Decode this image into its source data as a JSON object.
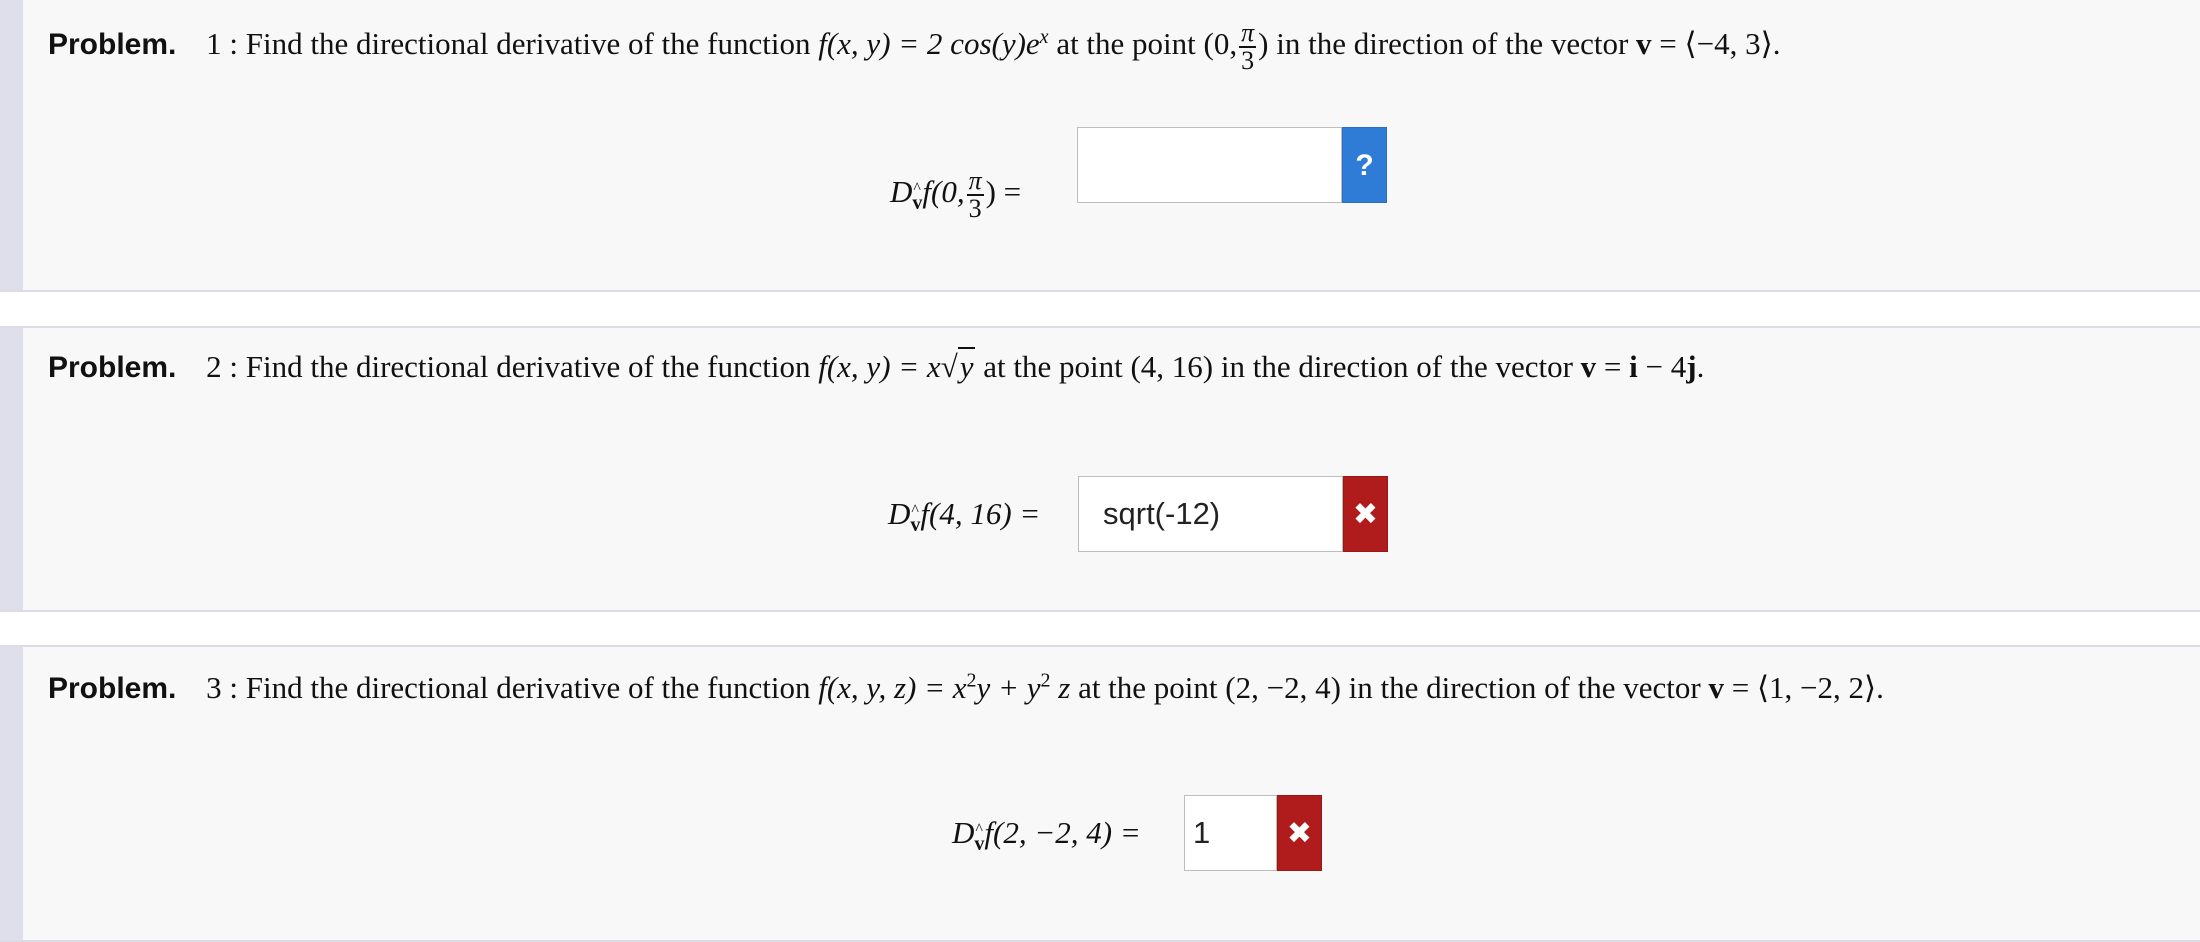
{
  "problems": [
    {
      "label": "Problem.",
      "number": "1 :",
      "text_intro": "Find the directional derivative of the function",
      "function_lhs": "f(x, y) = 2 cos(y)e",
      "function_sup": "x",
      "text_point": "at the point (0,",
      "point_frac_num": "π",
      "point_frac_den": "3",
      "text_point_end": ")",
      "text_direction": "in the direction of the vector",
      "vector_name": "v",
      "vector_value": "= ⟨−4, 3⟩.",
      "lhs_prefix": "D",
      "lhs_sub": "v",
      "lhs_args_open": "f(0,",
      "lhs_frac_num": "π",
      "lhs_frac_den": "3",
      "lhs_args_close": ") =",
      "input_value": "",
      "status_glyph": "?",
      "status": "unanswered"
    },
    {
      "label": "Problem.",
      "number": "2 :",
      "text_intro": "Find the directional derivative of the function",
      "function_lhs": "f(x, y) = x",
      "function_sqrt": "y",
      "text_point": "at the point (4, 16) in the direction of the vector",
      "vector_name": "v",
      "vector_value_i": "i",
      "vector_minus": " − 4",
      "vector_value_j": "j",
      "vector_end": ".",
      "lhs_prefix": "D",
      "lhs_sub": "v",
      "lhs_args": "f(4, 16) =",
      "input_value": "sqrt(-12)",
      "status_glyph": "✖",
      "status": "incorrect"
    },
    {
      "label": "Problem.",
      "number": "3 :",
      "text_intro": "Find the directional derivative of the function",
      "function_lhs": "f(x, y, z) = x",
      "function_sup1": "2",
      "function_mid": "y + y",
      "function_sup2": "2",
      "function_end": "z",
      "text_point": "at the point (2, −2, 4) in the direction of the vector",
      "vector_name": "v",
      "vector_value": "= ⟨1, −2, 2⟩.",
      "lhs_prefix": "D",
      "lhs_sub": "v",
      "lhs_args": "f(2, −2, 4) =",
      "input_value": "1",
      "status_glyph": "✖",
      "status": "incorrect"
    }
  ],
  "colors": {
    "unanswered_button": "#2f7cd6",
    "incorrect_button": "#b01c1c"
  }
}
